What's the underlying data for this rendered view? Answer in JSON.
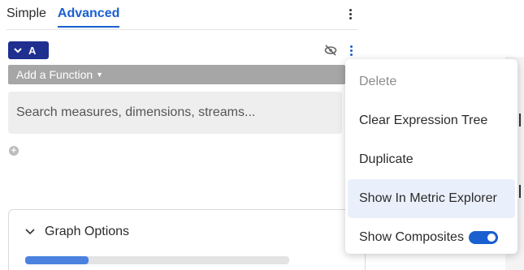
{
  "tabs": [
    {
      "label": "Simple",
      "active": false
    },
    {
      "label": "Advanced",
      "active": true
    }
  ],
  "query": {
    "chip_label": "A",
    "chip_icon": "chevron-down-icon",
    "visibility_icon": "eye-off-icon",
    "add_function_label": "Add a Function",
    "search_placeholder": "Search measures, dimensions, streams..."
  },
  "add_icon": "plus-circle-icon",
  "graph_options": {
    "title": "Graph Options",
    "slider_value": 0.24
  },
  "menu": {
    "items": [
      {
        "label": "Delete",
        "disabled": true
      },
      {
        "label": "Clear Expression Tree",
        "disabled": false
      },
      {
        "label": "Duplicate",
        "disabled": false
      },
      {
        "label": "Show In Metric Explorer",
        "disabled": false
      },
      {
        "label": "Show Composites",
        "disabled": false,
        "toggle_on": true
      }
    ]
  },
  "colors": {
    "accent": "#1a5fd0",
    "chip": "#1e2f8f",
    "function_bar": "#a6a6a6"
  }
}
